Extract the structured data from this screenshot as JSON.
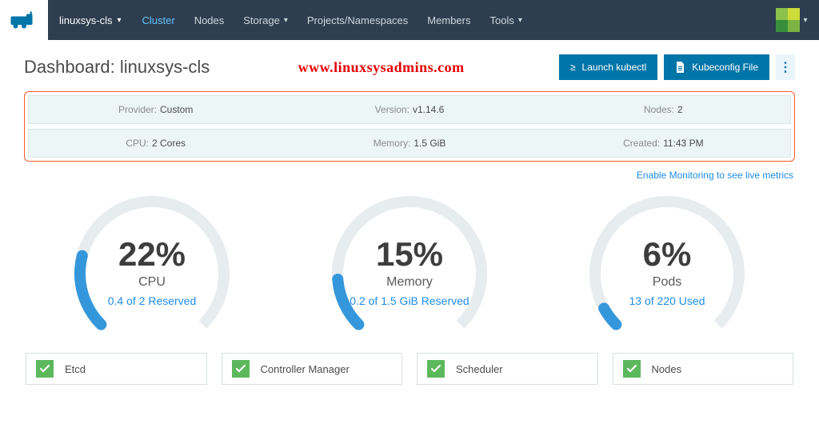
{
  "nav": {
    "cluster_selector": "linuxsys-cls",
    "items": [
      {
        "label": "Cluster",
        "active": true,
        "dropdown": false
      },
      {
        "label": "Nodes",
        "active": false,
        "dropdown": false
      },
      {
        "label": "Storage",
        "active": false,
        "dropdown": true
      },
      {
        "label": "Projects/Namespaces",
        "active": false,
        "dropdown": false
      },
      {
        "label": "Members",
        "active": false,
        "dropdown": false
      },
      {
        "label": "Tools",
        "active": false,
        "dropdown": true
      }
    ]
  },
  "header": {
    "title": "Dashboard: linuxsys-cls",
    "watermark": "www.linuxsysadmins.com",
    "launch_kubectl": "Launch kubectl",
    "kubeconfig": "Kubeconfig File"
  },
  "info": {
    "row1": [
      {
        "label": "Provider:",
        "value": "Custom"
      },
      {
        "label": "Version:",
        "value": "v1.14.6"
      },
      {
        "label": "Nodes:",
        "value": "2"
      }
    ],
    "row2": [
      {
        "label": "CPU:",
        "value": "2 Cores"
      },
      {
        "label": "Memory:",
        "value": "1.5 GiB"
      },
      {
        "label": "Created:",
        "value": "11:43 PM"
      }
    ]
  },
  "monitoring_link": "Enable Monitoring to see live metrics",
  "gauges": [
    {
      "percent": 22,
      "percent_text": "22%",
      "name": "CPU",
      "sub": "0.4 of 2 Reserved"
    },
    {
      "percent": 15,
      "percent_text": "15%",
      "name": "Memory",
      "sub": "0.2 of 1.5 GiB Reserved"
    },
    {
      "percent": 6,
      "percent_text": "6%",
      "name": "Pods",
      "sub": "13 of 220 Used"
    }
  ],
  "status": [
    {
      "label": "Etcd"
    },
    {
      "label": "Controller Manager"
    },
    {
      "label": "Scheduler"
    },
    {
      "label": "Nodes"
    }
  ],
  "chart_data": [
    {
      "type": "gauge",
      "title": "CPU",
      "value_percent": 22,
      "used": 0.4,
      "total": 2,
      "unit": "cores",
      "subtitle": "0.4 of 2 Reserved"
    },
    {
      "type": "gauge",
      "title": "Memory",
      "value_percent": 15,
      "used": 0.2,
      "total": 1.5,
      "unit": "GiB",
      "subtitle": "0.2 of 1.5 GiB Reserved"
    },
    {
      "type": "gauge",
      "title": "Pods",
      "value_percent": 6,
      "used": 13,
      "total": 220,
      "unit": "pods",
      "subtitle": "13 of 220 Used"
    }
  ]
}
